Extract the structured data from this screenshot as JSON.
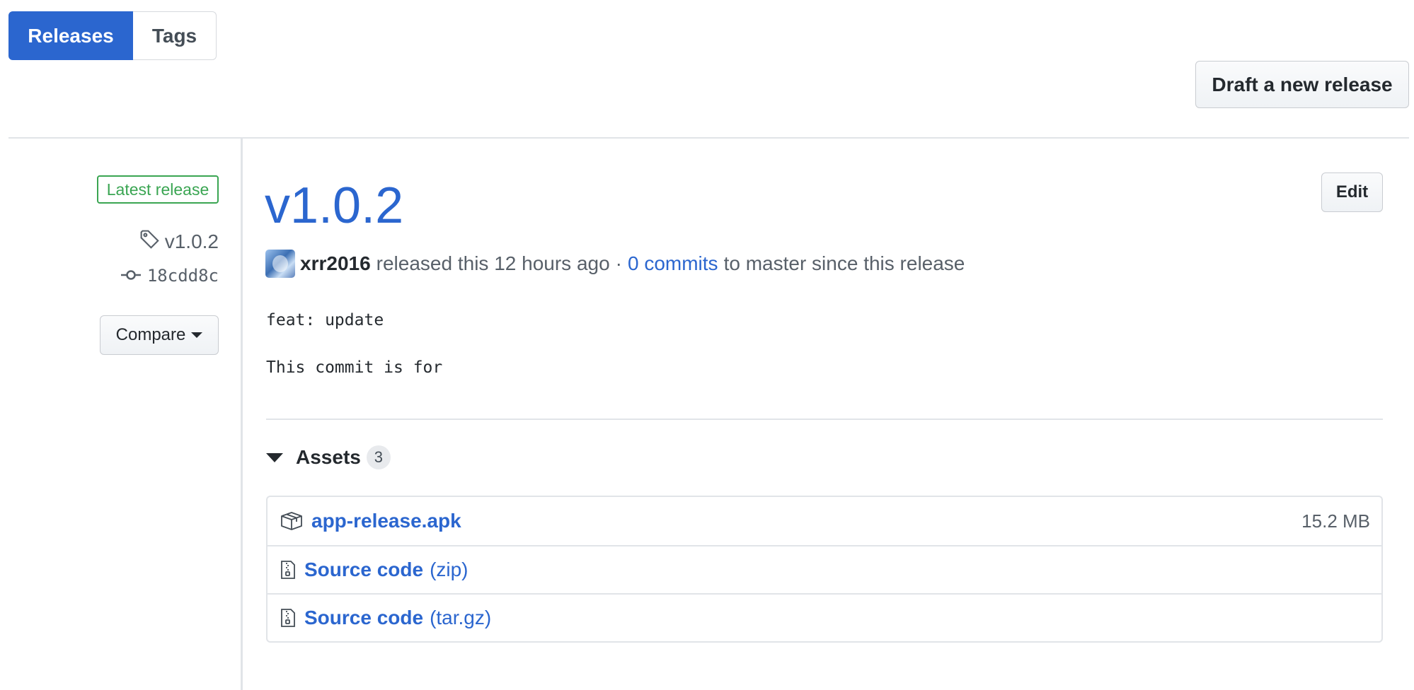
{
  "tabs": [
    {
      "label": "Releases",
      "selected": true
    },
    {
      "label": "Tags",
      "selected": false
    }
  ],
  "actions": {
    "draft_label": "Draft a new release",
    "edit_label": "Edit",
    "compare_label": "Compare"
  },
  "release": {
    "latest_badge": "Latest release",
    "tag": "v1.0.2",
    "commit": "18cdd8c",
    "title": "v1.0.2",
    "author": "xrr2016",
    "released_text": "released this 12 hours ago",
    "separator": "·",
    "commits_link": "0 commits",
    "commits_suffix": "to master since this release",
    "notes": [
      "feat: update",
      "This commit is for"
    ]
  },
  "assets": {
    "label": "Assets",
    "count": "3",
    "items": [
      {
        "name": "app-release.apk",
        "suffix": "",
        "size": "15.2 MB",
        "icon": "package-icon"
      },
      {
        "name": "Source code",
        "suffix": "(zip)",
        "size": "",
        "icon": "file-zip-icon"
      },
      {
        "name": "Source code",
        "suffix": "(tar.gz)",
        "size": "",
        "icon": "file-zip-icon"
      }
    ]
  },
  "colors": {
    "accent": "#2b66cf",
    "success": "#3aa552",
    "muted": "#586069",
    "border": "#e1e4e8"
  }
}
